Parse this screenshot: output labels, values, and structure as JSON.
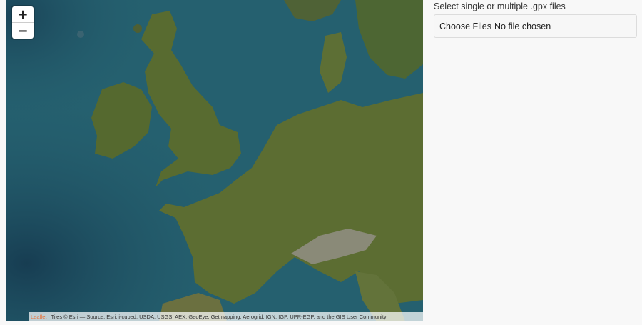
{
  "map": {
    "zoom_in_label": "+",
    "zoom_out_label": "−",
    "attribution": {
      "leaflet": "Leaflet",
      "rest": " | Tiles © Esri — Source: Esri, i-cubed, USDA, USGS, AEX, GeoEye, Getmapping, Aerogrid, IGN, IGP, UPR-EGP, and the GIS User Community"
    },
    "colors": {
      "ocean": "#25606f",
      "deep_ocean": "#1d4a5e",
      "land": "#5c6d32",
      "highland": "#6a6a48"
    }
  },
  "panel": {
    "label": "Select single or multiple .gpx files",
    "file_button": "Choose Files",
    "file_status": "No file chosen"
  }
}
